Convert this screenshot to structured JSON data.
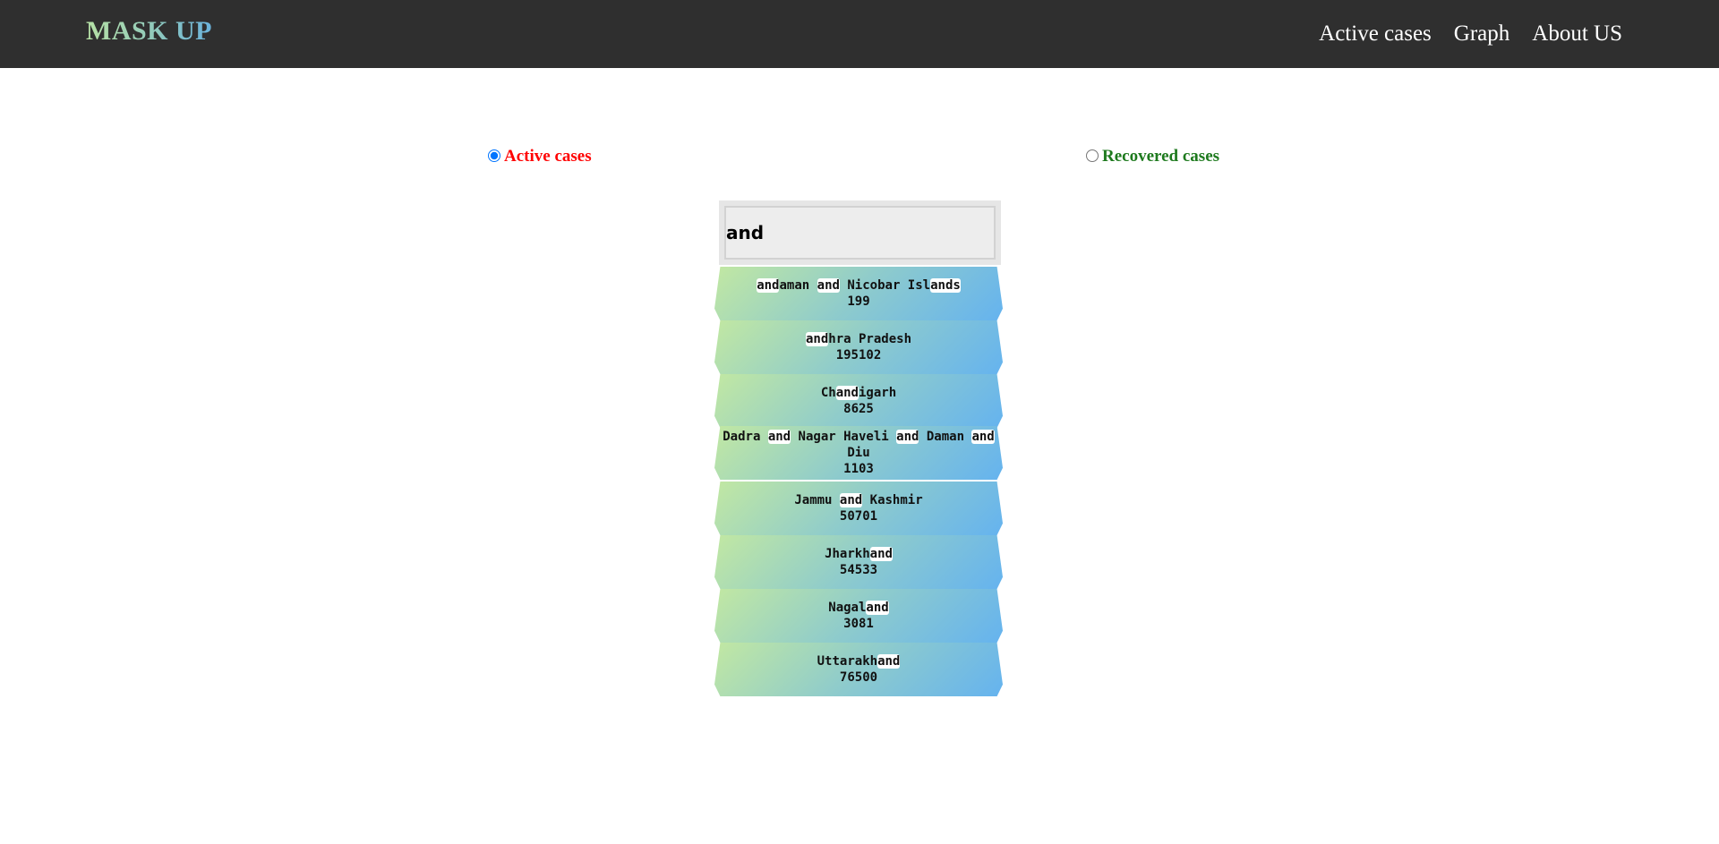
{
  "navbar": {
    "brand": "MASK UP",
    "links": [
      "Active cases",
      "Graph",
      "About US"
    ]
  },
  "filters": {
    "active_label": "Active cases",
    "recovered_label": "Recovered cases",
    "selected": "active"
  },
  "search": {
    "value": "and"
  },
  "results": [
    {
      "name_html": "<span class=\"hl\">and</span>aman <span class=\"hl\">and</span> Nicobar Isl<span class=\"hl\">ands</span>",
      "name": "Andaman and Nicobar Islands",
      "value": "199"
    },
    {
      "name_html": "<span class=\"hl\">and</span>hra Pradesh",
      "name": "Andhra Pradesh",
      "value": "195102"
    },
    {
      "name_html": "Ch<span class=\"hl\">and</span>igarh",
      "name": "Chandigarh",
      "value": "8625"
    },
    {
      "name_html": "Dadra <span class=\"hl\">and</span> Nagar Haveli <span class=\"hl\">and</span> Daman <span class=\"hl\">and</span> Diu",
      "name": "Dadra and Nagar Haveli and Daman and Diu",
      "value": "1103"
    },
    {
      "name_html": "Jammu <span class=\"hl\">and</span> Kashmir",
      "name": "Jammu and Kashmir",
      "value": "50701"
    },
    {
      "name_html": "Jharkh<span class=\"hl\">and</span>",
      "name": "Jharkhand",
      "value": "54533"
    },
    {
      "name_html": "Nagal<span class=\"hl\">and</span>",
      "name": "Nagaland",
      "value": "3081"
    },
    {
      "name_html": "Uttarakh<span class=\"hl\">and</span>",
      "name": "Uttarakhand",
      "value": "76500"
    }
  ]
}
